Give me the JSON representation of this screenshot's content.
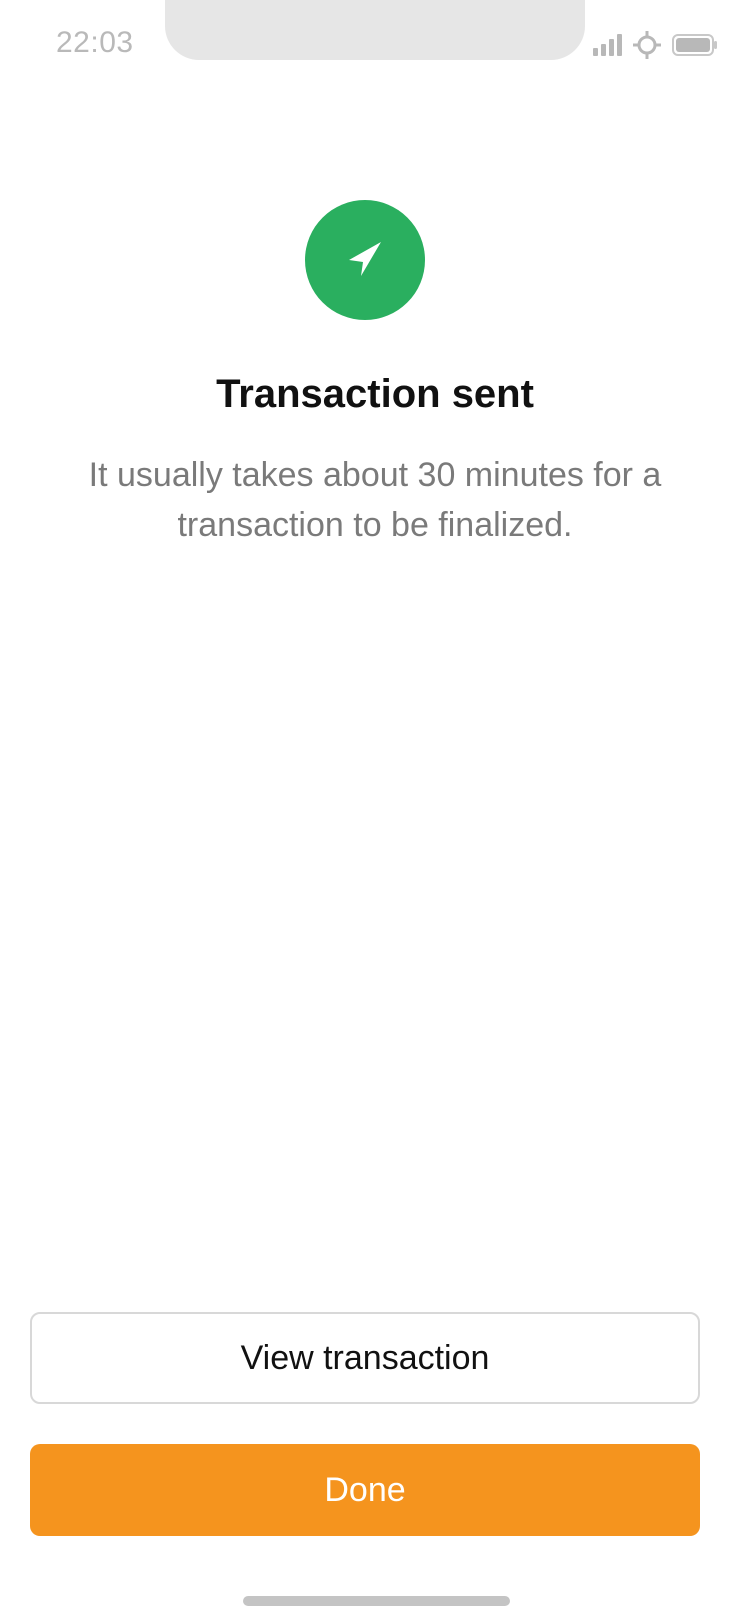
{
  "status_bar": {
    "time": "22:03",
    "icons": [
      "signal-icon",
      "location-icon",
      "battery-icon"
    ]
  },
  "main": {
    "icon": "send-icon",
    "icon_color": "#2aaf5f",
    "title": "Transaction sent",
    "subtitle": "It usually takes about 30 minutes for a transaction to be finalized."
  },
  "actions": {
    "view_transaction_label": "View transaction",
    "done_label": "Done",
    "done_color": "#f5941e"
  }
}
